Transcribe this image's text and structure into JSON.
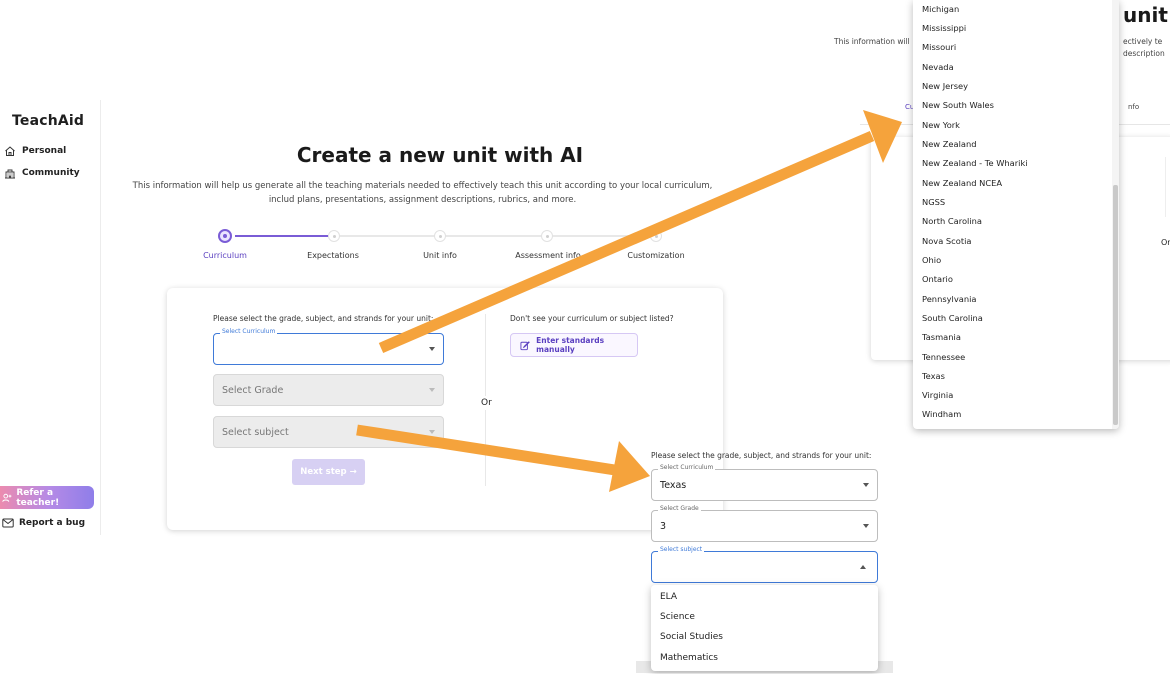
{
  "sidebar": {
    "brand": "TeachAid",
    "items": [
      {
        "label": "Personal",
        "icon": "home-icon"
      },
      {
        "label": "Community",
        "icon": "community-icon"
      }
    ],
    "refer_label": "Refer a teacher!",
    "bug_label": "Report a bug"
  },
  "main": {
    "title": "Create a new unit with AI",
    "description": "This information will help us generate all the teaching materials needed to effectively teach this unit according to your local curriculum, includ plans, presentations, assignment descriptions, rubrics, and more.",
    "steps": [
      "Curriculum",
      "Expectations",
      "Unit info",
      "Assessment info",
      "Customization"
    ],
    "active_step": 0,
    "form": {
      "prompt": "Please select the grade, subject, and strands for your unit:",
      "curriculum_legend": "Select Curriculum",
      "grade_placeholder": "Select Grade",
      "subject_placeholder": "Select subject",
      "next_label": "Next step →",
      "or_label": "Or",
      "manual_prompt": "Don't see your curriculum or subject listed?",
      "manual_label": "Enter standards manually"
    }
  },
  "inset_top": {
    "title_fragment": "v unit",
    "desc_left": "This information will",
    "desc_right_1": "ectively te",
    "desc_right_2": "description",
    "step_left": "Cu",
    "step_right": "nfo",
    "or_label": "Or",
    "curriculum_options": [
      "Michigan",
      "Mississippi",
      "Missouri",
      "Nevada",
      "New Jersey",
      "New South Wales",
      "New York",
      "New Zealand",
      "New Zealand - Te Whariki",
      "New Zealand NCEA",
      "NGSS",
      "North Carolina",
      "Nova Scotia",
      "Ohio",
      "Ontario",
      "Pennsylvania",
      "South Carolina",
      "Tasmania",
      "Tennessee",
      "Texas",
      "Virginia",
      "Windham"
    ]
  },
  "inset_bottom": {
    "prompt": "Please select the grade, subject, and strands for your unit:",
    "curriculum_legend": "Select Curriculum",
    "curriculum_value": "Texas",
    "grade_legend": "Select Grade",
    "grade_value": "3",
    "subject_legend": "Select subject",
    "subject_options": [
      "ELA",
      "Science",
      "Social Studies",
      "Mathematics"
    ]
  },
  "colors": {
    "accent": "#7a5cd6",
    "arrow": "#f5a33c",
    "focus_blue": "#3f7ad8"
  }
}
